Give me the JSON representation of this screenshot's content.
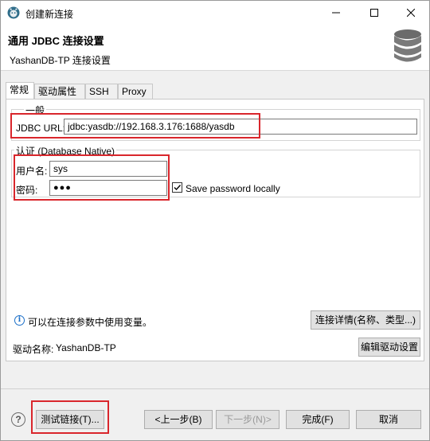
{
  "window": {
    "title": "创建新连接"
  },
  "header": {
    "title": "通用 JDBC 连接设置",
    "subtitle": "YashanDB-TP 连接设置"
  },
  "tabs": [
    {
      "label": "常规"
    },
    {
      "label": "驱动属性"
    },
    {
      "label": "SSH"
    },
    {
      "label": "Proxy"
    }
  ],
  "general_group": {
    "legend": "一般",
    "jdbc_url_label": "JDBC URL:",
    "jdbc_url_value": "jdbc:yasdb://192.168.3.176:1688/yasdb"
  },
  "auth_group": {
    "legend": "认证 (Database Native)",
    "username_label": "用户名:",
    "username_value": "sys",
    "password_label": "密码:",
    "password_value": "●●●",
    "save_password_label": "Save password locally",
    "save_password_checked": true
  },
  "info_text": "可以在连接参数中使用变量。",
  "connection_details_button": "连接详情(名称、类型...)",
  "driver_label": "驱动名称:",
  "driver_value": "YashanDB-TP",
  "edit_driver_button": "编辑驱动设置",
  "footer": {
    "test_connection": "测试链接(T)...",
    "back": "<上一步(B)",
    "next": "下一步(N)>",
    "finish": "完成(F)",
    "cancel": "取消"
  },
  "colors": {
    "highlight": "#d9262c",
    "icon_blue": "#1b6fc8"
  }
}
